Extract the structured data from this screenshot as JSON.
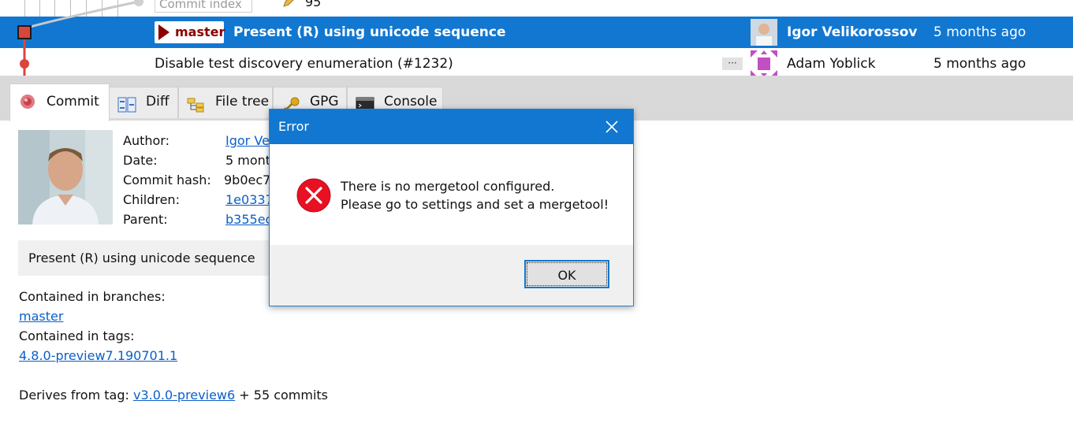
{
  "grid": {
    "partial_row": {
      "commit_index_placeholder": "Commit index",
      "commit_index_value": "95"
    },
    "selected_row": {
      "branch_label": "master",
      "subject": "Present (R) using unicode sequence",
      "author": "Igor Velikorossov",
      "date": "5 months ago"
    },
    "other_row": {
      "subject": "Disable test discovery enumeration (#1232)",
      "more_label": "···",
      "author": "Adam Yoblick",
      "date": "5 months ago"
    }
  },
  "tabs": [
    {
      "label": "Commit",
      "icon": "commit-icon",
      "active": true
    },
    {
      "label": "Diff",
      "icon": "diff-icon"
    },
    {
      "label": "File tree",
      "icon": "file-tree-icon"
    },
    {
      "label": "GPG",
      "icon": "key-icon"
    },
    {
      "label": "Console",
      "icon": "console-icon"
    }
  ],
  "details": {
    "author_label": "Author:",
    "author_value": "Igor Ve",
    "date_label": "Date:",
    "date_value": "5 mont",
    "hash_label": "Commit hash:",
    "hash_value": "9b0ec7",
    "children_label": "Children:",
    "children_value": "1e0337",
    "parent_label": "Parent:",
    "parent_value": "b355ec",
    "message": "Present (R) using unicode sequence",
    "branches_label": "Contained in branches:",
    "branch_link": "master",
    "tags_label": "Contained in tags:",
    "tag_link": "4.8.0-preview7.190701.1",
    "derives_label": "Derives from tag:",
    "derives_tag": "v3.0.0-preview6",
    "derives_suffix": "+ 55 commits"
  },
  "dialog": {
    "title": "Error",
    "message_line1": "There is no mergetool configured.",
    "message_line2": "Please go to settings and set a mergetool!",
    "ok_label": "OK",
    "accent_color": "#1177d1",
    "error_color": "#e81123"
  }
}
